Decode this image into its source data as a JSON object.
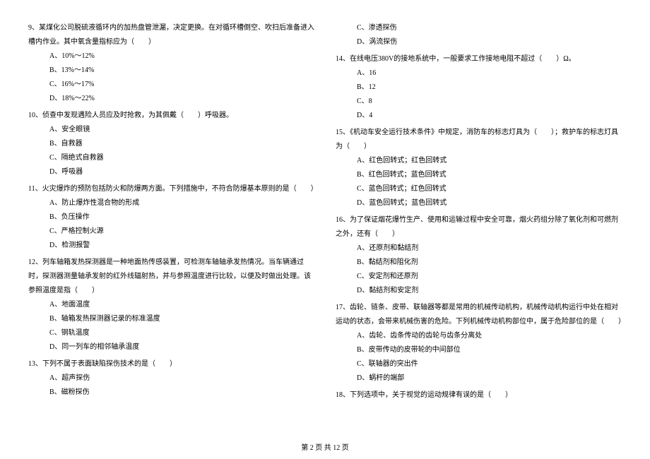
{
  "left": {
    "q9": {
      "text": "9、某煤化公司脱硫液循环内的加热盘管泄漏，决定更换。在对循环槽倒空、吹扫后准备进入槽内作业。其中氧含量指标应为（　　）",
      "a": "A、10%～12%",
      "b": "B、13%～14%",
      "c": "C、16%～17%",
      "d": "D、18%～22%"
    },
    "q10": {
      "text": "10、侦查中发现遇险人员应及时抢救，为其佩戴（　　）呼吸器。",
      "a": "A、安全眼镜",
      "b": "B、自救器",
      "c": "C、隔绝式自救器",
      "d": "D、呼吸器"
    },
    "q11": {
      "text": "11、火灾爆炸的预防包括防火和防爆两方面。下列措施中，不符合防爆基本原则的是（　　）",
      "a": "A、防止爆炸性混合物的形成",
      "b": "B、负压操作",
      "c": "C、严格控制火源",
      "d": "D、检测报警"
    },
    "q12": {
      "text": "12、列车轴箱发热探测器是一种地面热传感装置，可检测车轴轴承发热情况。当车辆通过时，探测器测量轴承发射的红外线辐射热，并与参照温度进行比较，以便及时做出处理。该参照温度是指（　　）",
      "a": "A、地面温度",
      "b": "B、轴箱发热探测器记录的标准温度",
      "c": "C、钢轨温度",
      "d": "D、同一列车的相邻轴承温度"
    },
    "q13": {
      "text": "13、下列不属于表面缺陷探伤技术的是（　　）",
      "a": "A、超声探伤",
      "b": "B、磁粉探伤"
    }
  },
  "right": {
    "q13c": "C、渗透探伤",
    "q13d": "D、涡流探伤",
    "q14": {
      "text": "14、在线电压380V的接地系统中，一般要求工作接地电阻不超过（　　）Ω。",
      "a": "A、16",
      "b": "B、12",
      "c": "C、8",
      "d": "D、4"
    },
    "q15": {
      "text": "15、《机动车安全运行技术条件》中规定，消防车的标志灯具为（　　）；救护车的标志灯具为（　　）",
      "a": "A、红色回转式；红色回转式",
      "b": "B、红色回转式；蓝色回转式",
      "c": "C、蓝色回转式；红色回转式",
      "d": "D、蓝色回转式；蓝色回转式"
    },
    "q16": {
      "text": "16、为了保证烟花爆竹生产、使用和运输过程中安全可靠，烟火药组分除了氧化剂和可燃剂之外，还有（　　）",
      "a": "A、还原剂和黏结剂",
      "b": "B、黏结剂和阻化剂",
      "c": "C、安定剂和还原剂",
      "d": "D、黏结剂和安定剂"
    },
    "q17": {
      "text": "17、齿轮、链条、皮带、联轴器等都是常用的机械传动机构，机械传动机构运行中处在相对运动的状态，会带来机械伤害的危险。下列机械传动机构部位中，属于危险部位的是（　　）",
      "a": "A、齿轮、齿条传动的齿轮与齿条分离处",
      "b": "B、皮带传动的皮带轮的中间部位",
      "c": "C、联轴器的突出件",
      "d": "D、蜗杆的端部"
    },
    "q18": {
      "text": "18、下列选项中，关于视觉的运动规律有误的是（　　）"
    }
  },
  "footer": "第 2 页 共 12 页"
}
